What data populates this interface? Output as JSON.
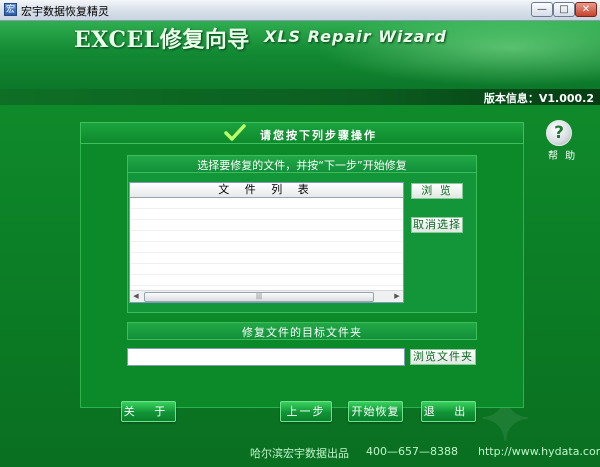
{
  "window": {
    "title": "宏宇数据恢复精灵",
    "icon": "app-icon",
    "controls": [
      "minimize-icon",
      "maximize-icon",
      "close-icon"
    ],
    "min_label": "—",
    "max_label": "□",
    "close_label": "✕"
  },
  "header": {
    "title": "EXCEL修复向导",
    "subtitle": "XLS Repair Wizard",
    "version": "版本信息：V1.000.2"
  },
  "panel": {
    "title": "请您按下列步骤操作",
    "instruction": "选择要修复的文件，并按“下一步”开始修复",
    "file_list_header": "文 件 列 表",
    "scroll_left": "◀",
    "scroll_right": "▶",
    "scroll_grip": "|||",
    "browse_button": "浏 览",
    "deselect_button": "取消选择",
    "target_label": "修复文件的目标文件夹",
    "target_value": "",
    "browse_folder_button": "浏览文件夹"
  },
  "help": {
    "label": "帮 助",
    "glyph": "?"
  },
  "buttons": {
    "about": "关 于",
    "prev": "上一步",
    "start": "开始恢复",
    "exit": "退 出"
  },
  "footer": {
    "company": "哈尔滨宏宇数据出品",
    "phone": "400—657—8388",
    "url": "http://www.hydata.com"
  },
  "colors": {
    "primary_green": "#0b7a24",
    "accent_green": "#39d15e",
    "panel_border": "#2db24d"
  }
}
